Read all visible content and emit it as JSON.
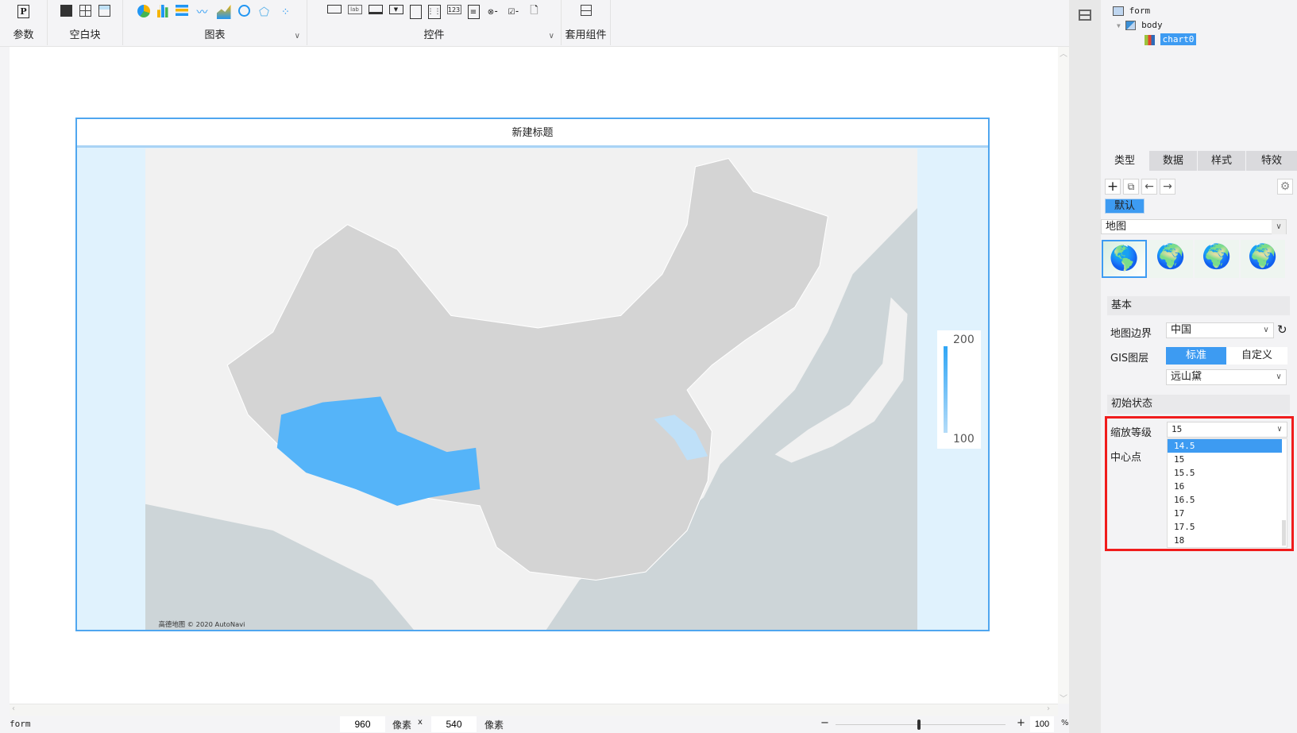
{
  "toolbar": {
    "groups": [
      {
        "label": "参数",
        "icons": [
          "parameter-icon"
        ]
      },
      {
        "label": "空白块",
        "icons": [
          "absolute-block-icon",
          "split-block-icon",
          "tab-block-icon"
        ]
      },
      {
        "label": "图表",
        "icons": [
          "pie-chart-icon",
          "bar-chart-icon",
          "horizontal-bar-icon",
          "line-chart-icon",
          "area-chart-icon",
          "gauge-chart-icon",
          "radar-chart-icon",
          "scatter-chart-icon"
        ]
      },
      {
        "label": "控件",
        "icons": [
          "button-widget-icon",
          "label-widget-icon",
          "text-widget-icon",
          "dropdown-widget-icon",
          "date-widget-icon",
          "calendar-widget-icon",
          "number-widget-icon",
          "list-widget-icon",
          "radio-group-icon",
          "checkbox-group-icon",
          "search-widget-icon"
        ]
      },
      {
        "label": "套用组件",
        "icons": [
          "template-component-icon"
        ]
      }
    ],
    "param_glyph": "P",
    "label_glyph": "lab",
    "number_glyph": "123"
  },
  "chart": {
    "title": "新建标题",
    "attribution": "高德地图 © 2020 AutoNavi",
    "legend": {
      "max": "200",
      "min": "100"
    },
    "colors": {
      "highlight": "#55b4f9",
      "light": "#bfe0f8",
      "land": "#d4d4d4"
    }
  },
  "status": {
    "name": "form",
    "width": "960",
    "unit1": "像素",
    "times": "x",
    "height": "540",
    "unit2": "像素",
    "zoom": "100",
    "percent": "%",
    "minus": "−",
    "plus": "+"
  },
  "tree": {
    "root": "form",
    "body": "body",
    "chart": "chart0"
  },
  "panel": {
    "tabs": [
      "类型",
      "数据",
      "样式",
      "特效"
    ],
    "default_label": "默认",
    "chart_type": "地图",
    "sections": {
      "basic": "基本",
      "initial": "初始状态"
    },
    "map_boundary_label": "地图边界",
    "map_boundary_value": "中国",
    "gis_label": "GIS图层",
    "gis_standard": "标准",
    "gis_custom": "自定义",
    "gis_style": "远山黛",
    "zoom_label": "缩放等级",
    "zoom_value": "15",
    "center_label": "中心点",
    "zoom_options": [
      "14.5",
      "15",
      "15.5",
      "16",
      "16.5",
      "17",
      "17.5",
      "18"
    ]
  }
}
